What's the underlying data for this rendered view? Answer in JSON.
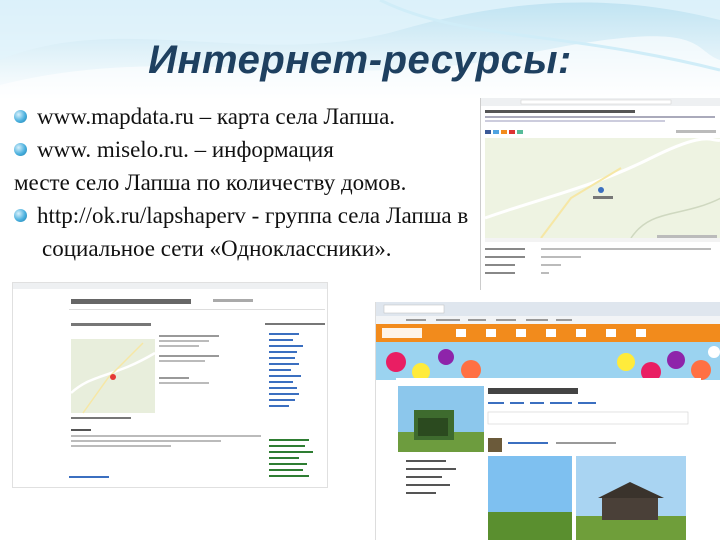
{
  "title": "Интернет-ресурсы:",
  "bullets": [
    "www.mapdata.ru – карта села Лапша.",
    "www. miselo.ru. – информация",
    "месте село Лапша по количеству домов.",
    "http://ok.ru/lapshaperv - группа села Лапша в",
    "социальное сети «Одноклассники»."
  ],
  "screens": {
    "mapdata": {
      "heading": "Карта села Лапша Пермского района"
    },
    "miselo": {
      "heading": "Информационный сайт Села Лапша"
    },
    "ok": {
      "group_title": "Лапша Пермский район",
      "site": "одноклассники"
    }
  },
  "colors": {
    "title": "#1e4060",
    "bullet": "#4ab0de",
    "ok_orange": "#f28b1c"
  }
}
